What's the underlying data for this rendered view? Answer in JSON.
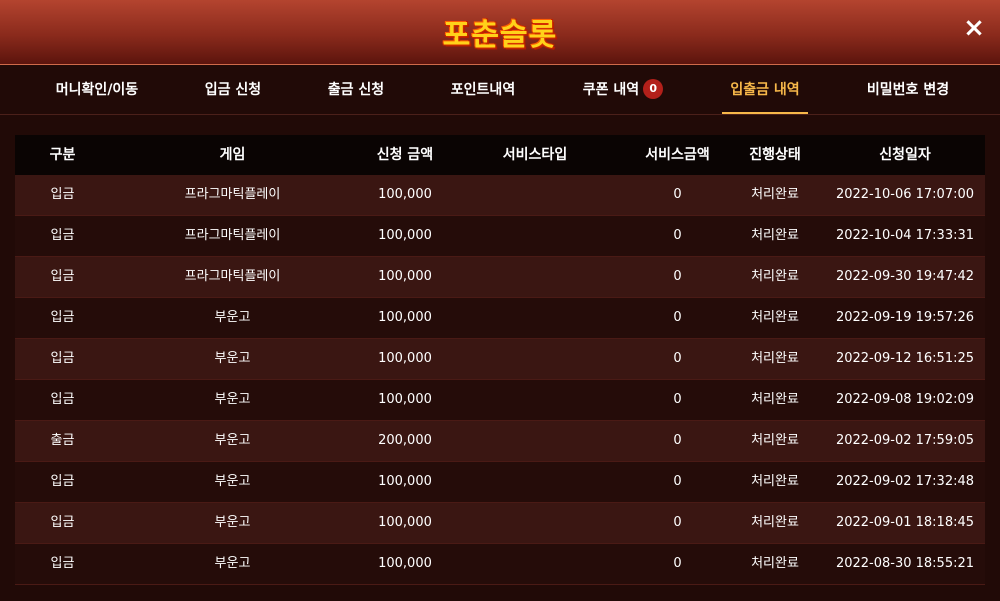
{
  "header": {
    "logo_text": "포춘슬롯",
    "close_label": "×"
  },
  "tabs": [
    {
      "label": "머니확인/이동"
    },
    {
      "label": "입금 신청"
    },
    {
      "label": "출금 신청"
    },
    {
      "label": "포인트내역"
    },
    {
      "label": "쿠폰 내역",
      "badge": "0"
    },
    {
      "label": "입출금 내역",
      "active": true
    },
    {
      "label": "비밀번호 변경"
    }
  ],
  "table": {
    "headers": [
      "구분",
      "게임",
      "신청 금액",
      "서비스타입",
      "서비스금액",
      "진행상태",
      "신청일자"
    ],
    "rows": [
      [
        "입금",
        "프라그마틱플레이",
        "100,000",
        "",
        "0",
        "처리완료",
        "2022-10-06 17:07:00"
      ],
      [
        "입금",
        "프라그마틱플레이",
        "100,000",
        "",
        "0",
        "처리완료",
        "2022-10-04 17:33:31"
      ],
      [
        "입금",
        "프라그마틱플레이",
        "100,000",
        "",
        "0",
        "처리완료",
        "2022-09-30 19:47:42"
      ],
      [
        "입금",
        "부운고",
        "100,000",
        "",
        "0",
        "처리완료",
        "2022-09-19 19:57:26"
      ],
      [
        "입금",
        "부운고",
        "100,000",
        "",
        "0",
        "처리완료",
        "2022-09-12 16:51:25"
      ],
      [
        "입금",
        "부운고",
        "100,000",
        "",
        "0",
        "처리완료",
        "2022-09-08 19:02:09"
      ],
      [
        "출금",
        "부운고",
        "200,000",
        "",
        "0",
        "처리완료",
        "2022-09-02 17:59:05"
      ],
      [
        "입금",
        "부운고",
        "100,000",
        "",
        "0",
        "처리완료",
        "2022-09-02 17:32:48"
      ],
      [
        "입금",
        "부운고",
        "100,000",
        "",
        "0",
        "처리완료",
        "2022-09-01 18:18:45"
      ],
      [
        "입금",
        "부운고",
        "100,000",
        "",
        "0",
        "처리완료",
        "2022-08-30 18:55:21"
      ]
    ]
  },
  "colors": {
    "accent": "#f7b84a",
    "badge": "#b3201a",
    "logo": "#ffd21a"
  }
}
